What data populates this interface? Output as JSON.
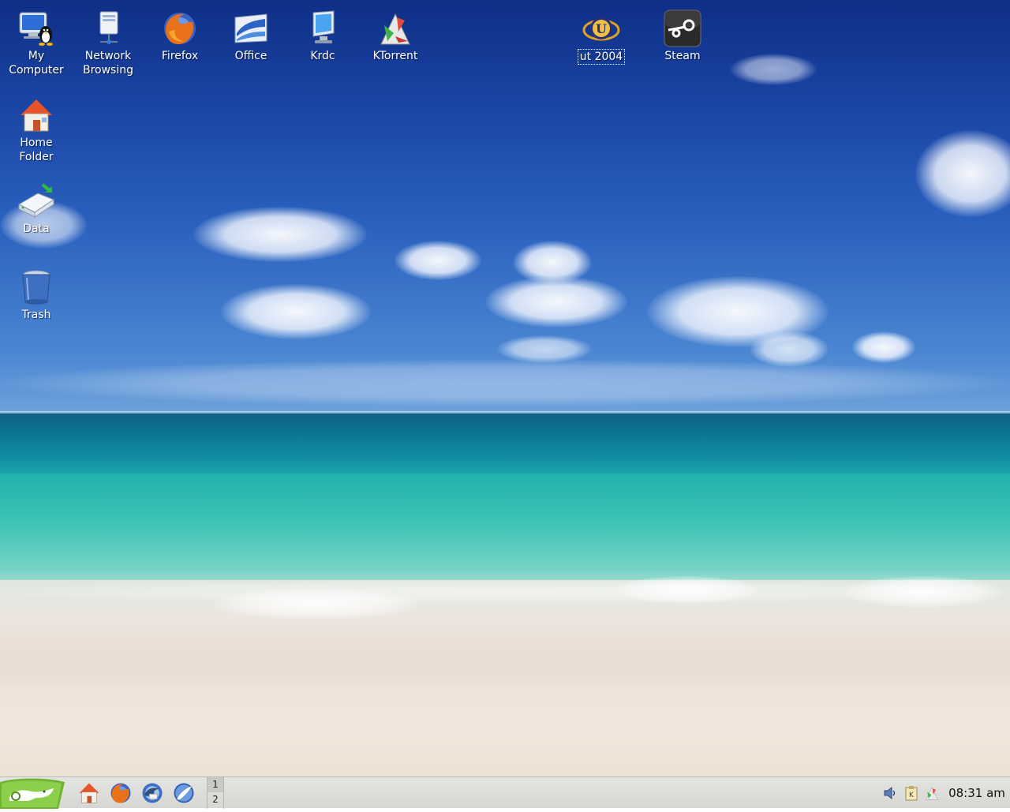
{
  "desktop_icons": {
    "my_computer": "My\nComputer",
    "network_browsing": "Network\nBrowsing",
    "firefox": "Firefox",
    "office": "Office",
    "krdc": "Krdc",
    "ktorrent": "KTorrent",
    "ut2004": "ut 2004",
    "steam": "Steam",
    "home_folder": "Home\nFolder",
    "data": "Data",
    "trash": "Trash"
  },
  "panel": {
    "pager": [
      "1",
      "2"
    ],
    "active_desktop": "1",
    "clock": "08:31 am",
    "launchers": [
      "home-icon",
      "firefox-icon",
      "thunderbird-icon",
      "kde-web-browser-icon"
    ],
    "tray": [
      "volume-icon",
      "klipper-icon",
      "ktorrent-icon"
    ],
    "kmenu_icon": "suse-gecko-icon"
  },
  "colors": {
    "panel_bg": "#d9d9d6",
    "label_text": "#ffffff",
    "sky_top": "#0e2f86",
    "sea": "#1da6aa"
  }
}
